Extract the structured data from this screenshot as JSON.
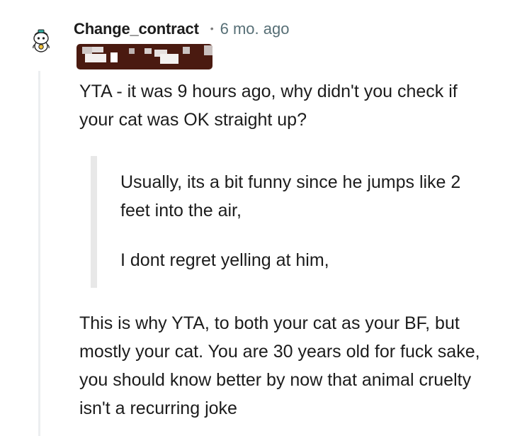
{
  "comment": {
    "username": "Change_contract",
    "separator": "•",
    "timestamp": "6 mo. ago",
    "avatar_icon": "snoo-avatar-icon",
    "flair_redacted": true,
    "flair_color": "#4a1a10",
    "body": {
      "paragraph_1": "YTA - it was 9 hours ago, why didn't you check if your cat was OK straight up?",
      "quote": [
        "Usually, its a bit funny since he jumps like 2 feet into the air,",
        "I dont regret yelling at him,"
      ],
      "paragraph_2": "This is why YTA, to both your cat as your BF, but mostly your cat. You are 30 years old for fuck sake, you should know better by now that animal cruelty isn't a recurring joke"
    }
  },
  "colors": {
    "text": "#1c1c1c",
    "timestamp": "#576f76",
    "thread_line": "#eceef0",
    "quote_bar": "#e8e8e8"
  }
}
